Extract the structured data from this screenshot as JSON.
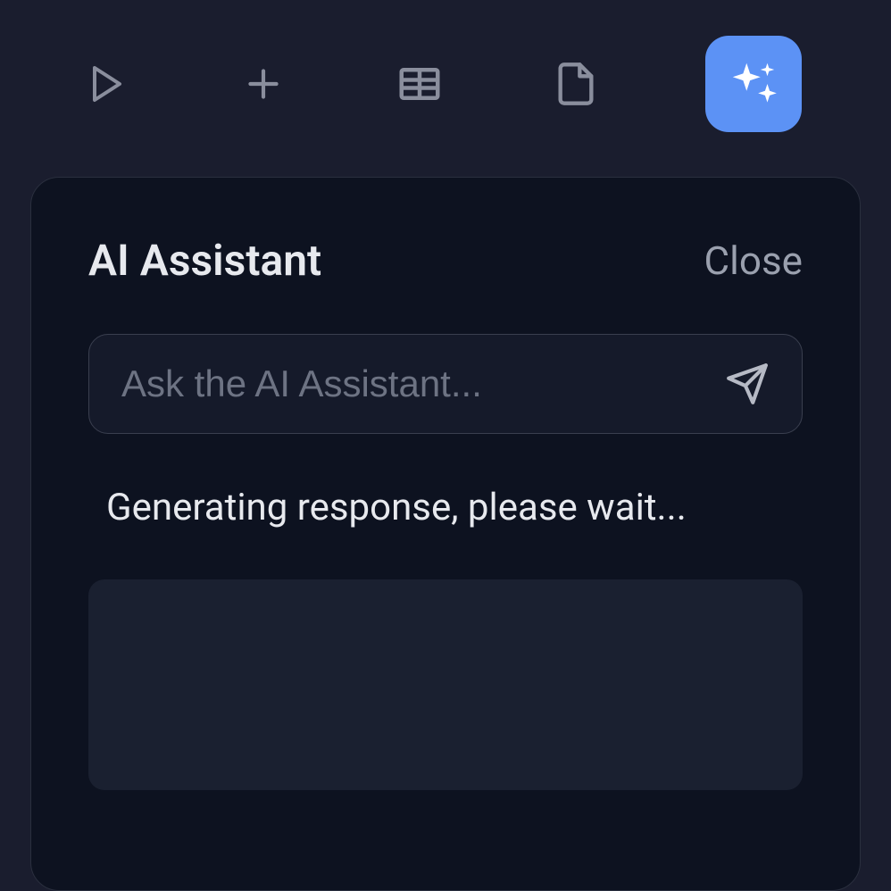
{
  "toolbar": {
    "items": [
      {
        "name": "play-icon"
      },
      {
        "name": "plus-icon"
      },
      {
        "name": "table-icon"
      },
      {
        "name": "file-icon"
      },
      {
        "name": "sparkles-icon",
        "active": true
      }
    ]
  },
  "panel": {
    "title": "AI Assistant",
    "close_label": "Close",
    "input_placeholder": "Ask the AI Assistant...",
    "status_text": "Generating response, please wait..."
  }
}
